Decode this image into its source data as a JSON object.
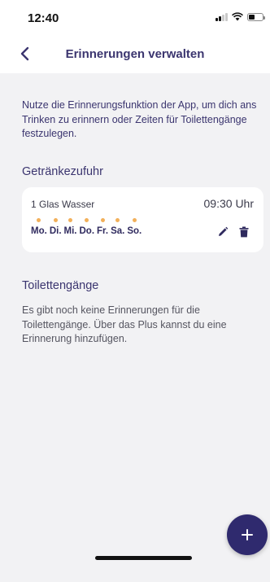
{
  "status_bar": {
    "time": "12:40",
    "battery_level": 0.45
  },
  "nav": {
    "title": "Erinnerungen verwalten",
    "back_icon": "chevron-left-icon"
  },
  "intro_text": "Nutze die Erinnerungsfunktion der App, um dich ans Trinken zu erinnern oder Zeiten für Toilettengänge festzulegen.",
  "drinks": {
    "title": "Getränkezufuhr",
    "reminders": [
      {
        "name": "1 Glas Wasser",
        "time": "09:30 Uhr",
        "days": [
          "Mo.",
          "Di.",
          "Mi.",
          "Do.",
          "Fr.",
          "Sa.",
          "So."
        ]
      }
    ]
  },
  "toilet": {
    "title": "Toilettengänge",
    "empty_text": "Es gibt noch keine Erinnerungen für die Toilettengänge. Über das Plus kannst du eine Erinnerung hinzufügen."
  },
  "colors": {
    "accent": "#2f2a6e",
    "title": "#3b356f",
    "day_dot": "#f2b05a",
    "background": "#f2f2f4"
  }
}
